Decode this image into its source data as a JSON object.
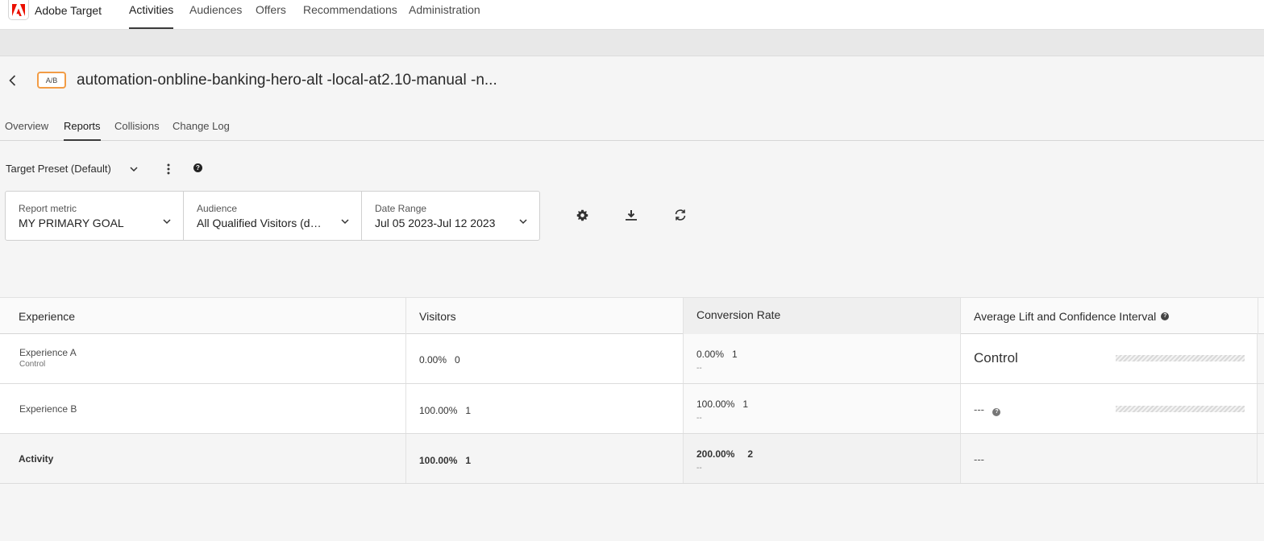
{
  "app": {
    "brand_name": "Adobe Target",
    "nav": [
      "Activities",
      "Audiences",
      "Offers",
      "Recommendations",
      "Administration"
    ],
    "active_nav": "Activities"
  },
  "activity": {
    "badge": "A/B",
    "title": "automation-onbline-banking-hero-alt -local-at2.10-manual -n..."
  },
  "tabs": [
    "Overview",
    "Reports",
    "Collisions",
    "Change Log"
  ],
  "active_tab": "Reports",
  "preset": {
    "label": "Target Preset (Default)"
  },
  "filters": {
    "metric": {
      "label": "Report metric",
      "value": "MY PRIMARY GOAL"
    },
    "audience": {
      "label": "Audience",
      "value": "All Qualified Visitors (de..."
    },
    "date": {
      "label": "Date Range",
      "value": "Jul 05 2023-Jul 12 2023"
    }
  },
  "tools": [
    "gear-icon",
    "download-icon",
    "refresh-icon"
  ],
  "table": {
    "headers": {
      "experience": "Experience",
      "visitors": "Visitors",
      "conversion": "Conversion Rate",
      "lift": "Average Lift and Confidence Interval"
    },
    "rows": [
      {
        "name": "Experience A",
        "sub": "Control",
        "visitors_pct": "0.00%",
        "visitors_count": "0",
        "conv_pct": "0.00%",
        "conv_count": "1",
        "conv_sub": "--",
        "lift": "Control"
      },
      {
        "name": "Experience B",
        "sub": "",
        "visitors_pct": "100.00%",
        "visitors_count": "1",
        "conv_pct": "100.00%",
        "conv_count": "1",
        "conv_sub": "--",
        "lift": "---"
      }
    ],
    "total": {
      "name": "Activity",
      "visitors_pct": "100.00%",
      "visitors_count": "1",
      "conv_pct": "200.00%",
      "conv_count": "2",
      "conv_sub": "--",
      "lift": "---"
    }
  },
  "colors": {
    "badge_border": "#f29c45",
    "brand_red": "#eb1000"
  }
}
